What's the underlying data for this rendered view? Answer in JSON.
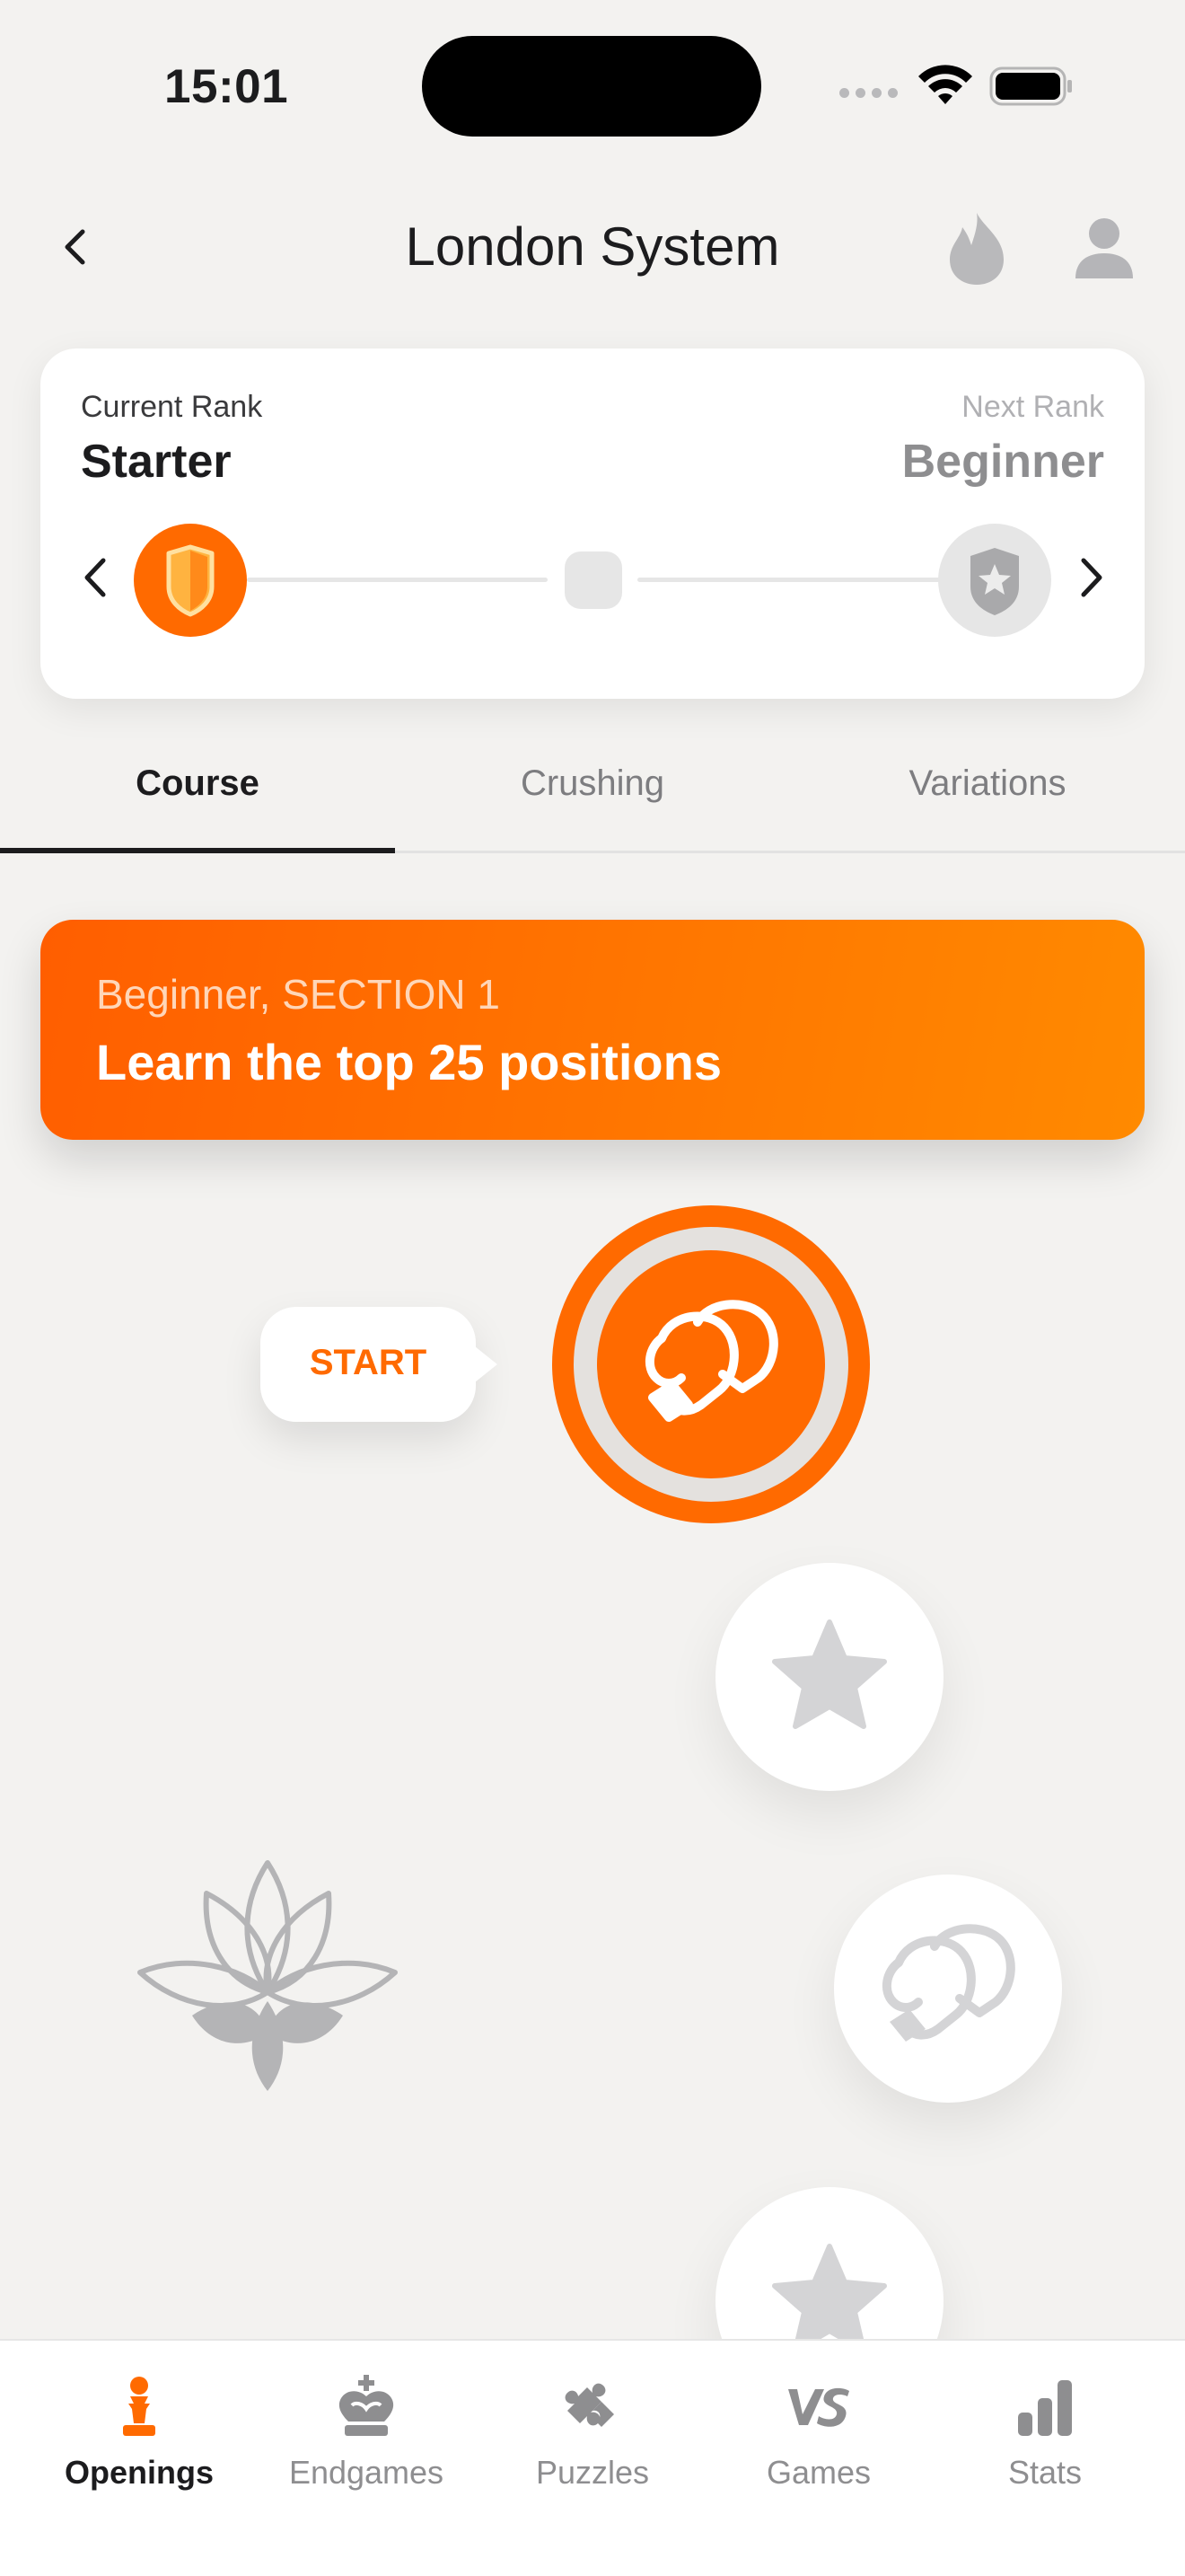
{
  "status_bar": {
    "time": "15:01"
  },
  "header": {
    "title": "London System"
  },
  "rank": {
    "current_label": "Current Rank",
    "current_value": "Starter",
    "next_label": "Next Rank",
    "next_value": "Beginner"
  },
  "tabs": [
    {
      "label": "Course",
      "active": true
    },
    {
      "label": "Crushing",
      "active": false
    },
    {
      "label": "Variations",
      "active": false
    }
  ],
  "section": {
    "subtitle": "Beginner, SECTION 1",
    "title": "Learn the top 25 positions"
  },
  "path": {
    "start_label": "START",
    "nodes": [
      {
        "icon": "boxing-gloves-icon",
        "state": "active"
      },
      {
        "icon": "star-icon",
        "state": "locked"
      },
      {
        "icon": "boxing-gloves-icon",
        "state": "locked"
      },
      {
        "icon": "star-icon",
        "state": "locked"
      }
    ],
    "milestone_icon": "lotus-icon"
  },
  "bottom_nav": [
    {
      "label": "Openings",
      "icon": "pawn-icon",
      "active": true
    },
    {
      "label": "Endgames",
      "icon": "king-icon",
      "active": false
    },
    {
      "label": "Puzzles",
      "icon": "puzzle-icon",
      "active": false
    },
    {
      "label": "Games",
      "icon": "vs-icon",
      "active": false
    },
    {
      "label": "Stats",
      "icon": "bar-chart-icon",
      "active": false
    }
  ],
  "colors": {
    "accent": "#ff6a00",
    "background": "#f3f2f0",
    "inactive": "#8e8e90"
  }
}
